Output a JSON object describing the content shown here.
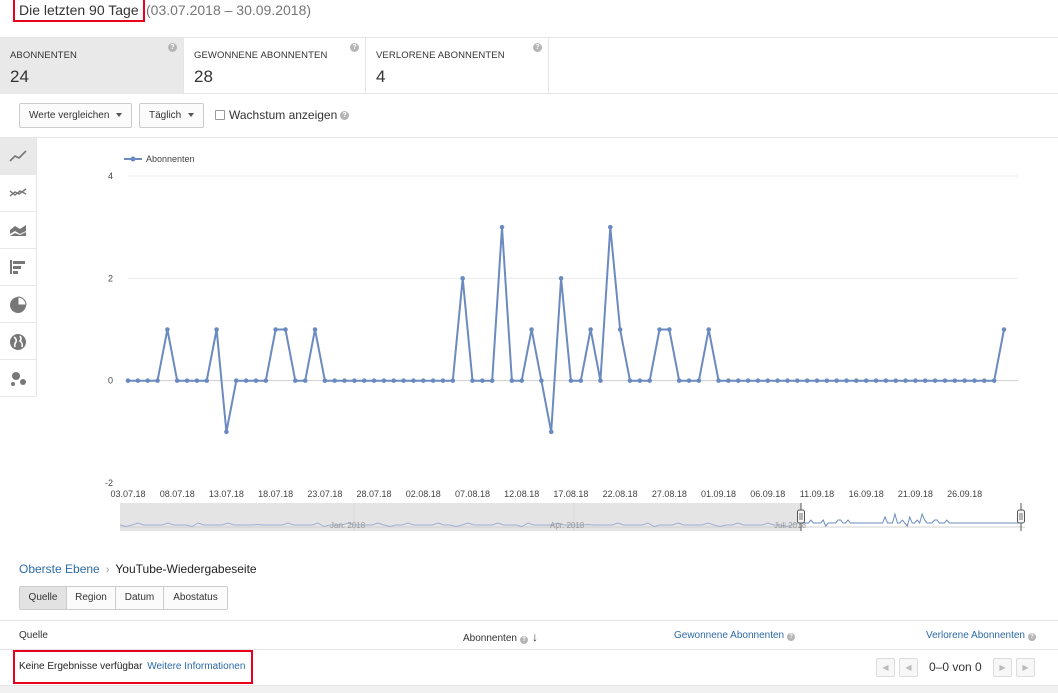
{
  "range": {
    "title": "Die letzten 90 Tage",
    "dates": "(03.07.2018 – 30.09.2018)"
  },
  "metrics": [
    {
      "label": "ABONNENTEN",
      "value": "24",
      "active": true
    },
    {
      "label": "GEWONNENE ABONNENTEN",
      "value": "28",
      "active": false
    },
    {
      "label": "VERLORENE ABONNENTEN",
      "value": "4",
      "active": false
    }
  ],
  "toolbar": {
    "compare_label": "Werte vergleichen",
    "interval_label": "Täglich",
    "growth_label": "Wachstum anzeigen",
    "growth_checked": false
  },
  "chart_types": [
    {
      "icon": "line-chart-icon",
      "active": true
    },
    {
      "icon": "multi-line-chart-icon",
      "active": false
    },
    {
      "icon": "stacked-area-chart-icon",
      "active": false
    },
    {
      "icon": "bar-chart-icon",
      "active": false
    },
    {
      "icon": "pie-chart-icon",
      "active": false
    },
    {
      "icon": "map-globe-icon",
      "active": false
    },
    {
      "icon": "bubble-chart-icon",
      "active": false
    }
  ],
  "chart_data": {
    "type": "line",
    "legend_position": "top-left",
    "series": [
      {
        "name": "Abonnenten",
        "color": "#6b8bc0",
        "values": [
          0,
          0,
          0,
          0,
          1,
          0,
          0,
          0,
          0,
          1,
          -1,
          0,
          0,
          0,
          0,
          1,
          1,
          0,
          0,
          1,
          0,
          0,
          0,
          0,
          0,
          0,
          0,
          0,
          0,
          0,
          0,
          0,
          0,
          0,
          2,
          0,
          0,
          0,
          3,
          0,
          0,
          1,
          0,
          -1,
          2,
          0,
          0,
          1,
          0,
          3,
          1,
          0,
          0,
          0,
          1,
          1,
          0,
          0,
          0,
          1,
          0,
          0,
          0,
          0,
          0,
          0,
          0,
          0,
          0,
          0,
          0,
          0,
          0,
          0,
          0,
          0,
          0,
          0,
          0,
          0,
          0,
          0,
          0,
          0,
          0,
          0,
          0,
          0,
          0,
          1
        ]
      }
    ],
    "x": {
      "start": "03.07.2018",
      "count": 90
    },
    "ylim": [
      -2,
      4
    ],
    "yticks": [
      -2,
      0,
      2,
      4
    ],
    "xtick_labels": [
      "03.07.18",
      "08.07.18",
      "13.07.18",
      "18.07.18",
      "23.07.18",
      "28.07.18",
      "02.08.18",
      "07.08.18",
      "12.08.18",
      "17.08.18",
      "22.08.18",
      "27.08.18",
      "01.09.18",
      "06.09.18",
      "11.09.18",
      "16.09.18",
      "21.09.18",
      "26.09.18"
    ],
    "xtick_step_days": 5,
    "grid": true,
    "navigator": {
      "labels": [
        "Jan. 2018",
        "Apr. 2018",
        "Juli 2018"
      ]
    }
  },
  "breadcrumb": {
    "root": "Oberste Ebene",
    "separator": "›",
    "current": "YouTube-Wiedergabeseite"
  },
  "dimension_tabs": [
    {
      "label": "Quelle",
      "active": true
    },
    {
      "label": "Region",
      "active": false
    },
    {
      "label": "Datum",
      "active": false
    },
    {
      "label": "Abostatus",
      "active": false
    }
  ],
  "table": {
    "columns": {
      "source": "Quelle",
      "subscribers": "Abonnenten",
      "gained": "Gewonnene Abonnenten",
      "lost": "Verlorene Abonnenten"
    },
    "empty_text": "Keine Ergebnisse verfügbar",
    "more_info": "Weitere Informationen",
    "pager_text": "0–0 von 0"
  }
}
